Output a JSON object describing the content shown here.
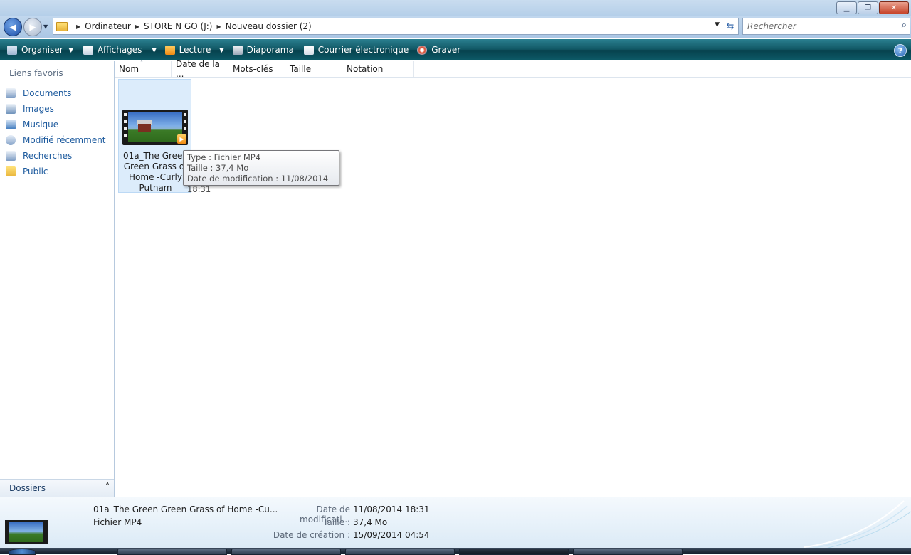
{
  "window": {
    "minimize_label": "▁",
    "maximize_label": "❐",
    "close_label": "✕"
  },
  "addressbar": {
    "crumbs": [
      "Ordinateur",
      "STORE N GO (J:)",
      "Nouveau dossier (2)"
    ],
    "search_placeholder": "Rechercher"
  },
  "toolbar": {
    "organize": "Organiser",
    "views": "Affichages",
    "play": "Lecture",
    "slideshow": "Diaporama",
    "email": "Courrier électronique",
    "burn": "Graver"
  },
  "navpane": {
    "favorites_heading": "Liens favoris",
    "favorites": [
      "Documents",
      "Images",
      "Musique",
      "Modifié récemment",
      "Recherches",
      "Public"
    ],
    "folders_label": "Dossiers"
  },
  "columns": [
    "Nom",
    "Date de la ...",
    "Mots-clés",
    "Taille",
    "Notation"
  ],
  "file": {
    "name_lines": [
      "01a_The Green",
      "Green Grass of",
      "Home -Curly",
      "Putnam"
    ]
  },
  "tooltip": {
    "type_line": "Type : Fichier MP4",
    "size_line": "Taille : 37,4 Mo",
    "date_line": "Date de modification : 11/08/2014 18:31"
  },
  "details": {
    "name": "01a_The Green Green Grass of Home -Cu...",
    "type": "Fichier MP4",
    "modified_label": "Date de modificati...",
    "modified_value": "11/08/2014 18:31",
    "size_label": "Taille :",
    "size_value": "37,4 Mo",
    "created_label": "Date de création :",
    "created_value": "15/09/2014 04:54"
  },
  "colors": {
    "link_blue": "#1e5b9e",
    "command_bar": "#115764",
    "selection": "#dcecfb"
  }
}
